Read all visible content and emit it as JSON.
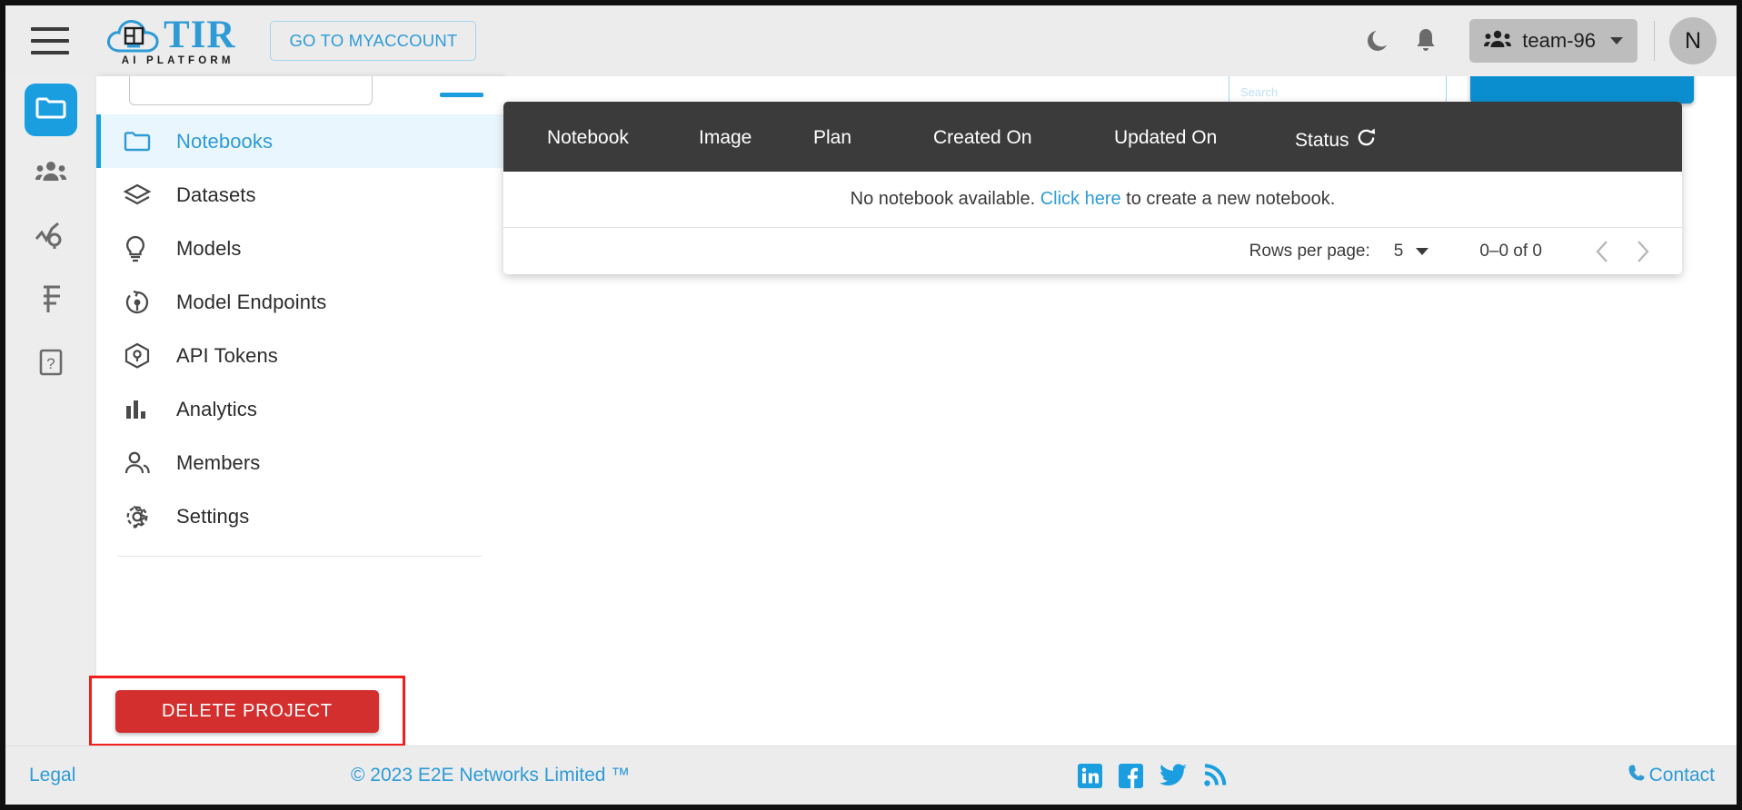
{
  "header": {
    "menu_icon": "hamburger-icon",
    "brand_name": "TIR",
    "brand_tagline": "AI PLATFORM",
    "goto_account_label": "GO TO MYACCOUNT",
    "dark_mode_icon": "moon-icon",
    "notifications_icon": "bell-icon",
    "team_icon": "people-group-icon",
    "team_label": "team-96",
    "avatar_initial": "N",
    "accent_color": "#2e9bd6",
    "chip_color": "#bdbdbd"
  },
  "rail": {
    "items": [
      {
        "name": "projects",
        "icon": "folder-icon",
        "active": true
      },
      {
        "name": "teams",
        "icon": "people-group-icon",
        "active": false
      },
      {
        "name": "monitoring",
        "icon": "chart-search-icon",
        "active": false
      },
      {
        "name": "billing",
        "icon": "rupee-icon",
        "active": false
      },
      {
        "name": "help",
        "icon": "question-box-icon",
        "active": false
      }
    ],
    "active_color": "#1a9ee0"
  },
  "sidebar": {
    "project_select_value": "",
    "items": [
      {
        "label": "Notebooks",
        "icon": "folder-icon",
        "active": true
      },
      {
        "label": "Datasets",
        "icon": "layers-icon",
        "active": false
      },
      {
        "label": "Models",
        "icon": "lightbulb-icon",
        "active": false
      },
      {
        "label": "Model Endpoints",
        "icon": "endpoint-icon",
        "active": false
      },
      {
        "label": "API Tokens",
        "icon": "cube-icon",
        "active": false
      },
      {
        "label": "Analytics",
        "icon": "bar-chart-icon",
        "active": false
      },
      {
        "label": "Members",
        "icon": "person-icon",
        "active": false
      },
      {
        "label": "Settings",
        "icon": "gear-icon",
        "active": false
      }
    ],
    "delete_project_label": "DELETE PROJECT",
    "delete_button_color": "#d32f2f",
    "annotation_color": "#f21d1d"
  },
  "content": {
    "search_placeholder": "Search",
    "table": {
      "columns": [
        "Notebook",
        "Image",
        "Plan",
        "Created On",
        "Updated On",
        "Status"
      ],
      "status_refresh_icon": "refresh-icon",
      "header_bg": "#3b3b3b",
      "empty_message_before": "No notebook available. ",
      "empty_link": "Click here",
      "empty_message_after": " to create a new notebook.",
      "rows": []
    },
    "pagination": {
      "rows_per_page_label": "Rows per page:",
      "rows_per_page_value": "5",
      "range_label": "0–0 of 0",
      "prev_icon": "chevron-left-icon",
      "next_icon": "chevron-right-icon"
    }
  },
  "footer": {
    "legal_label": "Legal",
    "copyright": "© 2023 E2E Networks Limited ™",
    "socials": [
      {
        "name": "linkedin-icon"
      },
      {
        "name": "facebook-icon"
      },
      {
        "name": "twitter-icon"
      },
      {
        "name": "rss-icon"
      }
    ],
    "contact_label": "Contact",
    "contact_icon": "phone-icon",
    "link_color": "#2e9bd6"
  }
}
